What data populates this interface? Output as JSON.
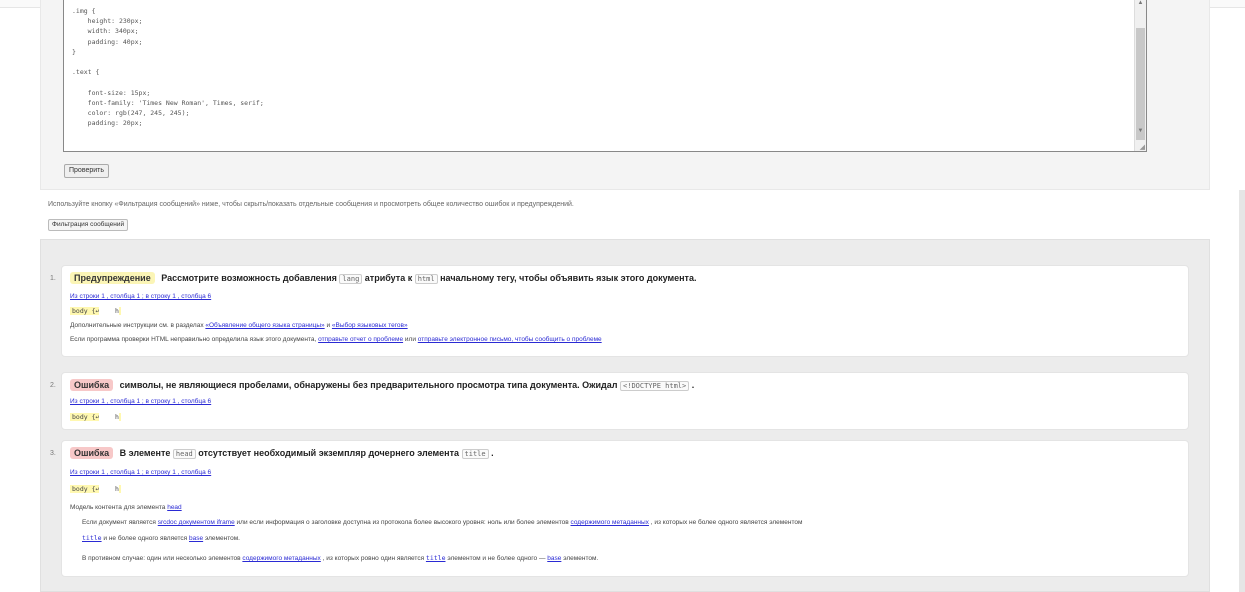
{
  "editor": {
    "code": ".img {\n    height: 230px;\n    width: 340px;\n    padding: 40px;\n}\n\n.text {\n\n    font-size: 15px;\n    font-family: 'Times New Roman', Times, serif;\n    color: rgb(247, 245, 245);\n    padding: 20px;"
  },
  "check_button": "Проверить",
  "hint": "Используйте кнопку «Фильтрация сообщений» ниже, чтобы скрыть/показать отдельные сообщения и просмотреть общее количество ошибок и предупреждений.",
  "filter_button": "Фильтрация сообщений",
  "messages": [
    {
      "num": "1.",
      "badge": "Предупреждение",
      "text_1": "Рассмотрите возможность добавления",
      "code_1": "lang",
      "text_2": "атрибута к",
      "code_2": "html",
      "text_3": "начальному тегу, чтобы объявить язык этого документа.",
      "location": "Из строки 1 , столбца 1 ; в строку 1 , столбца 6",
      "extract": "body {↩",
      "extract_tail": "    h",
      "info_1": "Дополнительные инструкции см. в разделах",
      "info_link_1": "«Объявление общего языка страницы»",
      "info_and": "и",
      "info_link_2": "«Выбор языковых тегов»",
      "info_2": "Если программа проверки HTML неправильно определила язык этого документа,",
      "info_link_3": "отправьте отчет о проблеме",
      "info_or": "или",
      "info_link_4": "отправьте электронное письмо, чтобы сообщить о проблеме"
    },
    {
      "num": "2.",
      "badge": "Ошибка",
      "text_1": "символы, не являющиеся пробелами, обнаружены без предварительного просмотра типа документа. Ожидал",
      "code_1": "<!DOCTYPE html>",
      "text_2": ".",
      "location": "Из строки 1 , столбца 1 ; в строку 1 , столбца 6",
      "extract": "body {↩",
      "extract_tail": "    h"
    },
    {
      "num": "3.",
      "badge": "Ошибка",
      "text_1": "В элементе",
      "code_1": "head",
      "text_2": "отсутствует необходимый экземпляр дочернего элемента",
      "code_2": "title",
      "text_3": ".",
      "location": "Из строки 1 , столбца 1 ; в строку 1 , столбца 6",
      "extract": "body {↩",
      "extract_tail": "    h",
      "ctx_label": "Модель контента для элемента",
      "ctx_link": "head",
      "ctx_1a": "Если документ является",
      "ctx_1b": "srcdoc документом iframe",
      "ctx_1c": "или если информация о заголовке доступна из протокола более высокого уровня: ноль или более элементов",
      "ctx_1d": "содержимого метаданных",
      "ctx_1e": ", из которых не более одного является элементом",
      "ctx_1f": "title",
      "ctx_1g": "и не более одного является",
      "ctx_1h": "base",
      "ctx_1i": "элементом.",
      "ctx_2a": "В противном случае: один или несколько элементов",
      "ctx_2b": "содержимого метаданных",
      "ctx_2c": ", из которых ровно один является",
      "ctx_2d": "title",
      "ctx_2e": "элементом и не более одного —",
      "ctx_2f": "base",
      "ctx_2g": "элементом."
    }
  ]
}
